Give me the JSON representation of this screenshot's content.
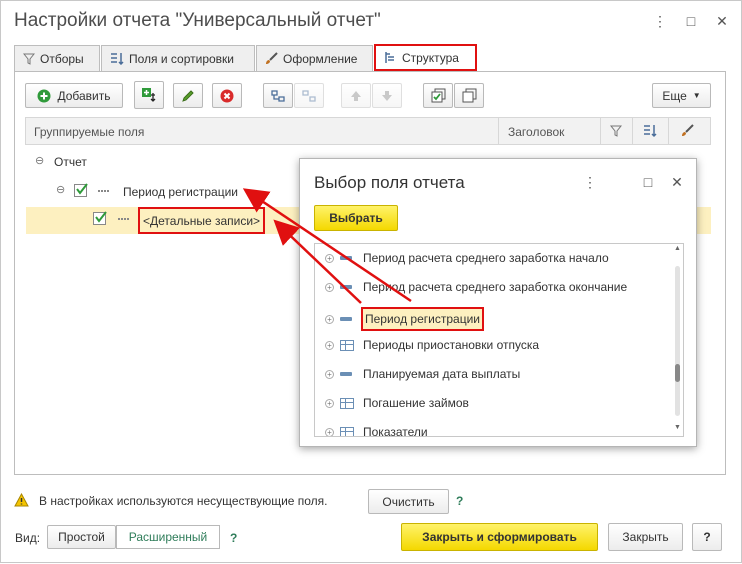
{
  "window": {
    "title": "Настройки отчета \"Универсальный отчет\"",
    "controls": [
      "⋮",
      "□",
      "✕"
    ]
  },
  "tabs": [
    {
      "label": "Отборы",
      "icon": "filter-icon"
    },
    {
      "label": "Поля и сортировки",
      "icon": "fields-sort-icon"
    },
    {
      "label": "Оформление",
      "icon": "brush-icon"
    },
    {
      "label": "Структура",
      "icon": "structure-icon",
      "active": true
    }
  ],
  "toolbar": {
    "add_label": "Добавить",
    "more_label": "Еще"
  },
  "grid": {
    "col_fields": "Группируемые поля",
    "col_title": "Заголовок",
    "rows": [
      {
        "label": "Отчет"
      },
      {
        "label": "Период регистрации",
        "checked": true
      },
      {
        "label": "<Детальные записи>",
        "checked": true,
        "selected": true
      }
    ]
  },
  "dialog": {
    "title": "Выбор поля отчета",
    "controls": [
      "⋮",
      "□",
      "✕"
    ],
    "select_label": "Выбрать",
    "items": [
      {
        "label": "Период расчета среднего заработка начало",
        "icon": "field"
      },
      {
        "label": "Период расчета среднего заработка окончание",
        "icon": "field"
      },
      {
        "label": "Период регистрации",
        "icon": "field",
        "highlighted": true
      },
      {
        "label": "Периоды приостановки отпуска",
        "icon": "table"
      },
      {
        "label": "Планируемая дата выплаты",
        "icon": "field"
      },
      {
        "label": "Погашение займов",
        "icon": "table"
      },
      {
        "label": "Показатели",
        "icon": "table"
      }
    ]
  },
  "warning": {
    "text": "В настройках используются несуществующие поля.",
    "clear_label": "Очистить",
    "help": "?"
  },
  "footer": {
    "view_label": "Вид:",
    "view_simple": "Простой",
    "view_extended": "Расширенный",
    "help": "?",
    "close_build_label": "Закрыть и сформировать",
    "close_label": "Закрыть",
    "help_button": "?"
  },
  "colors": {
    "accent_red": "#e01010",
    "yellow": "#f4d800",
    "selection": "#fdf0c0"
  }
}
